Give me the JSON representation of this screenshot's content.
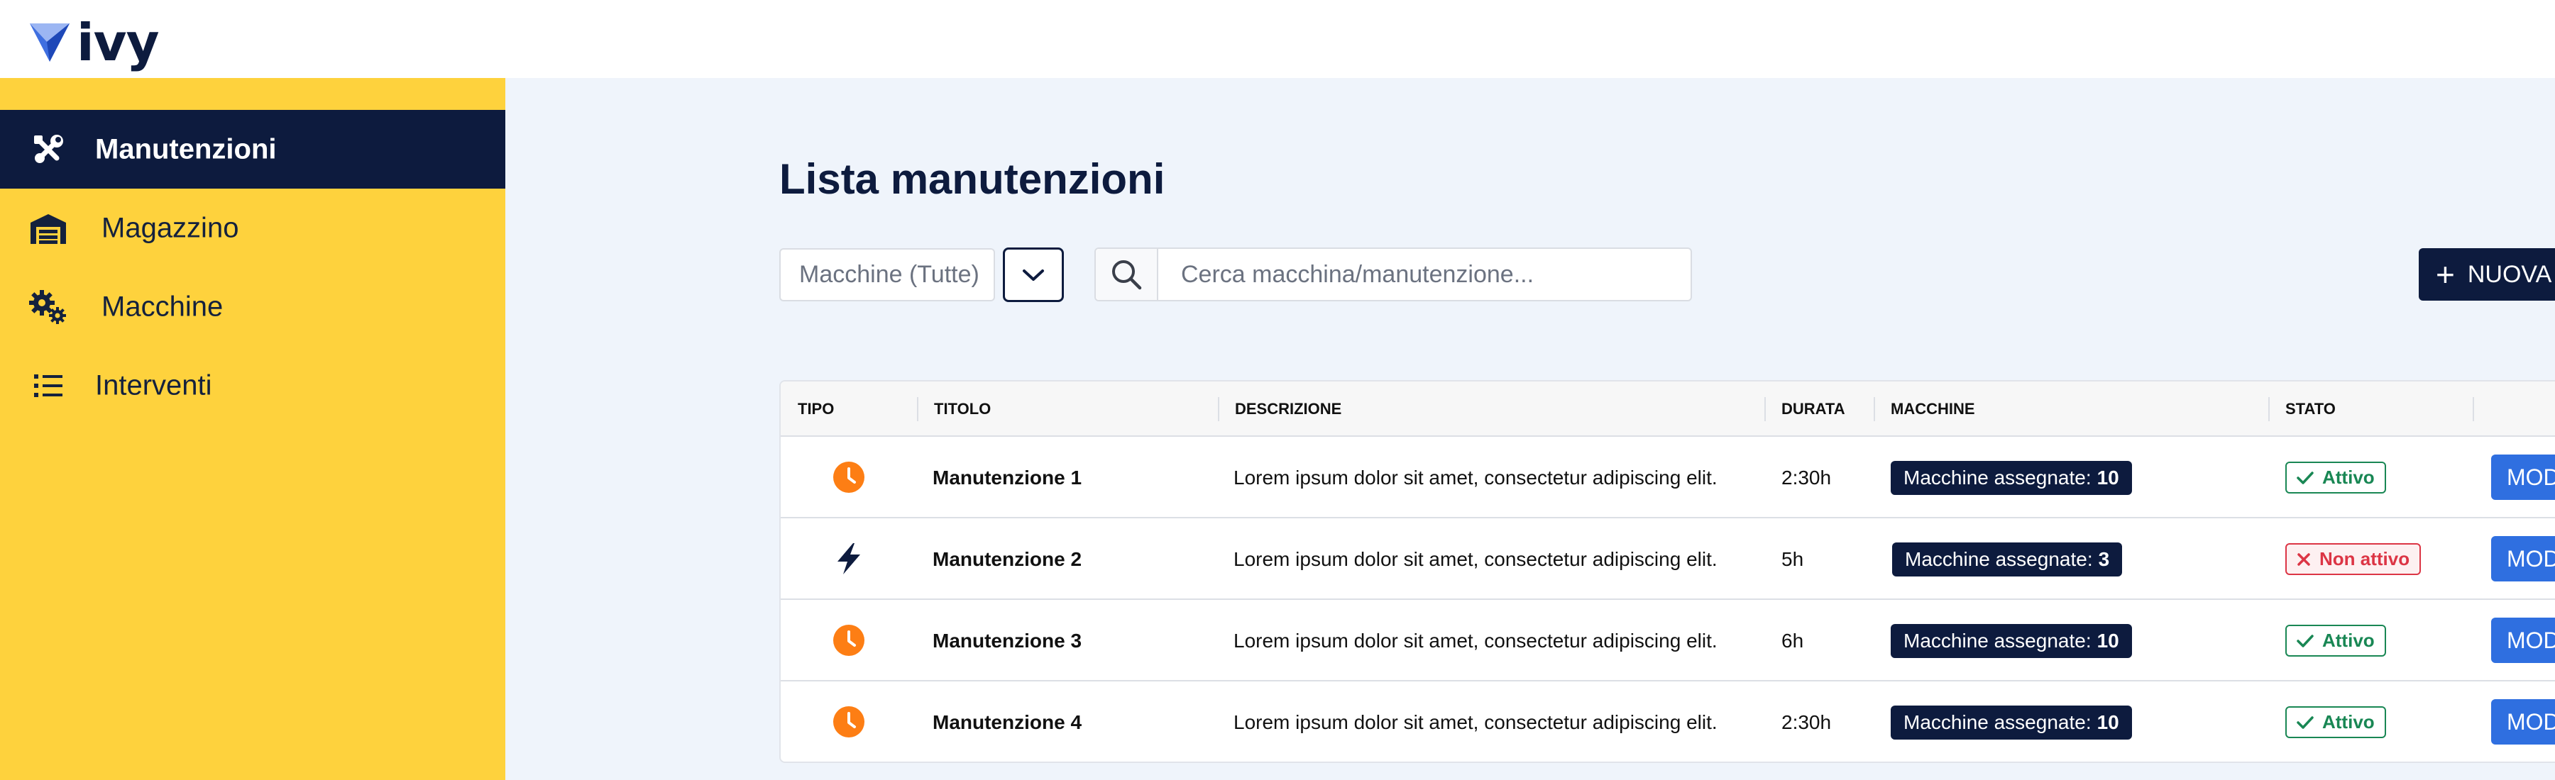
{
  "app": {
    "logo_text": "ivy"
  },
  "sidebar": {
    "items": [
      {
        "label": "Manutenzioni",
        "icon": "tools-icon",
        "active": true
      },
      {
        "label": "Magazzino",
        "icon": "warehouse-icon",
        "active": false
      },
      {
        "label": "Macchine",
        "icon": "gears-icon",
        "active": false
      },
      {
        "label": "Interventi",
        "icon": "list-icon",
        "active": false
      }
    ]
  },
  "main": {
    "title": "Lista manutenzioni",
    "filter": {
      "placeholder": "Macchine (Tutte)"
    },
    "search": {
      "placeholder": "Cerca macchina/manutenzione..."
    },
    "new_button": {
      "label": "NUOVA MANUTENZIONE"
    }
  },
  "table": {
    "columns": [
      "TIPO",
      "TITOLO",
      "DESCRIZIONE",
      "DURATA",
      "MACCHINE",
      "STATO"
    ],
    "machines_label": "Macchine assegnate:",
    "edit_label": "MODIFICA",
    "rows": [
      {
        "type": "clock-icon",
        "title": "Manutenzione 1",
        "description": "Lorem ipsum dolor sit amet, consectetur adipiscing elit.",
        "duration": "2:30h",
        "machines": "10",
        "status": "Attivo",
        "active": true
      },
      {
        "type": "bolt-icon",
        "title": "Manutenzione 2",
        "description": "Lorem ipsum dolor sit amet, consectetur adipiscing elit.",
        "duration": "5h",
        "machines": "3",
        "status": "Non attivo",
        "active": false
      },
      {
        "type": "clock-icon",
        "title": "Manutenzione 3",
        "description": "Lorem ipsum dolor sit amet, consectetur adipiscing elit.",
        "duration": "6h",
        "machines": "10",
        "status": "Attivo",
        "active": true
      },
      {
        "type": "clock-icon",
        "title": "Manutenzione 4",
        "description": "Lorem ipsum dolor sit amet, consectetur adipiscing elit.",
        "duration": "2:30h",
        "machines": "10",
        "status": "Attivo",
        "active": true
      }
    ]
  },
  "colors": {
    "navy": "#0d1b3e",
    "sidebar_yellow": "#fed23d",
    "background": "#eff4fb",
    "clock_orange": "#fd7e14",
    "success_green": "#198754",
    "danger_red": "#dc3545",
    "edit_blue": "#2f6fe0"
  }
}
